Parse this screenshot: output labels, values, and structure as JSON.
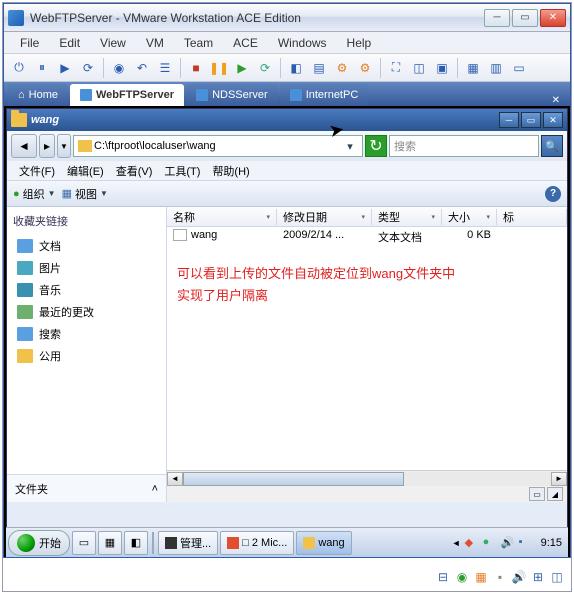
{
  "vmware": {
    "title": "WebFTPServer - VMware Workstation ACE Edition",
    "menus": [
      "File",
      "Edit",
      "View",
      "VM",
      "Team",
      "ACE",
      "Windows",
      "Help"
    ],
    "tabs": {
      "home": "Home",
      "active": "WebFTPServer",
      "nds": "NDSServer",
      "pc": "InternetPC"
    }
  },
  "explorer": {
    "title": "wang",
    "path": "C:\\ftproot\\localuser\\wang",
    "search_placeholder": "搜索",
    "menus": {
      "file": "文件(F)",
      "edit": "编辑(E)",
      "view": "查看(V)",
      "tools": "工具(T)",
      "help": "帮助(H)"
    },
    "toolbar": {
      "organize": "组织",
      "views": "视图"
    },
    "sidebar": {
      "title": "收藏夹链接",
      "items": [
        {
          "label": "文档",
          "color": "#5aa0e0"
        },
        {
          "label": "图片",
          "color": "#4aa8c0"
        },
        {
          "label": "音乐",
          "color": "#3a90b0"
        },
        {
          "label": "最近的更改",
          "color": "#6eb06e"
        },
        {
          "label": "搜索",
          "color": "#5aa0e0"
        },
        {
          "label": "公用",
          "color": "#f0c24a"
        }
      ],
      "folders_label": "文件夹"
    },
    "columns": {
      "name": "名称",
      "modified": "修改日期",
      "type": "类型",
      "size": "大小",
      "tag": "标"
    },
    "row": {
      "name": "wang",
      "modified": "2009/2/14 ...",
      "type": "文本文档",
      "size": "0 KB"
    },
    "annotation": "可以看到上传的文件自动被定位到wang文件夹中    实现了用户隔离"
  },
  "taskbar": {
    "start": "开始",
    "items": [
      {
        "label": "管理...",
        "icon": "#333"
      },
      {
        "label": "2 Mic...",
        "icon": "#e05030",
        "prefix": "□ "
      },
      {
        "label": "wang",
        "icon": "#f0c24a",
        "active": true
      }
    ],
    "clock": "9:15"
  }
}
